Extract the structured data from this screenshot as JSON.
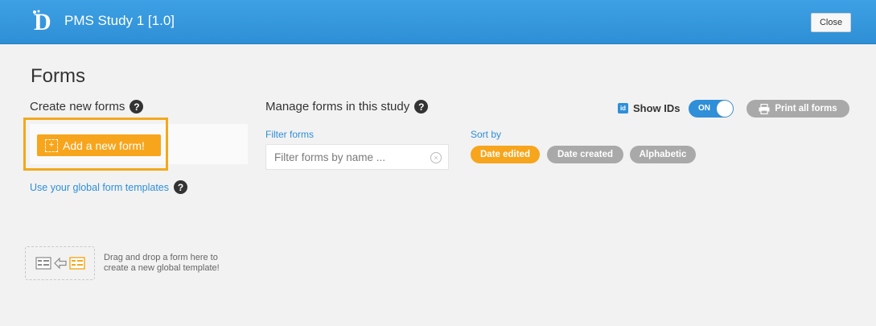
{
  "header": {
    "logo_letter": "D",
    "app_title": "PMS Study 1 [1.0]",
    "close_label": "Close"
  },
  "page": {
    "title": "Forms"
  },
  "create": {
    "heading": "Create new forms",
    "add_button_label": "Add a new form!",
    "global_templates_link": "Use your global form templates",
    "drop_text_line1": "Drag and drop a form here to",
    "drop_text_line2": "create a new global template!"
  },
  "manage": {
    "heading": "Manage forms in this study",
    "filter_label": "Filter forms",
    "filter_placeholder": "Filter forms by name ...",
    "sort_label": "Sort by",
    "sort_options": [
      "Date edited",
      "Date created",
      "Alphabetic"
    ],
    "sort_selected": "Date edited",
    "show_ids_label": "Show IDs",
    "id_icon_text": "id",
    "toggle_label": "ON",
    "print_label": "Print all forms"
  },
  "colors": {
    "header_blue": "#3ea0e4",
    "accent_orange": "#f7a51c",
    "link_blue": "#2f8fd8",
    "pill_gray": "#a9a9a9"
  },
  "icons": [
    "logo-d-icon",
    "help-icon",
    "add-icon",
    "clear-icon",
    "id-icon",
    "printer-icon",
    "form-template-icon",
    "arrow-left-icon",
    "form-icon"
  ]
}
